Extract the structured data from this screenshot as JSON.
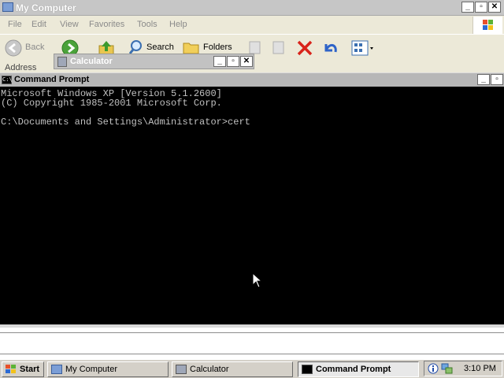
{
  "my_computer": {
    "title": "My Computer",
    "menu": [
      "File",
      "Edit",
      "View",
      "Favorites",
      "Tools",
      "Help"
    ],
    "toolbar": {
      "back_label": "Back",
      "search_label": "Search",
      "folders_label": "Folders"
    },
    "address_label": "Address"
  },
  "calculator": {
    "title": "Calculator"
  },
  "command_prompt": {
    "title": "Command Prompt",
    "lines": [
      "Microsoft Windows XP [Version 5.1.2600]",
      "(C) Copyright 1985-2001 Microsoft Corp.",
      "",
      "C:\\Documents and Settings\\Administrator>cert"
    ]
  },
  "taskbar": {
    "start_label": "Start",
    "tasks": [
      {
        "label": "My Computer",
        "active": false
      },
      {
        "label": "Calculator",
        "active": false
      },
      {
        "label": "Command Prompt",
        "active": true
      }
    ],
    "clock": "3:10 PM"
  }
}
